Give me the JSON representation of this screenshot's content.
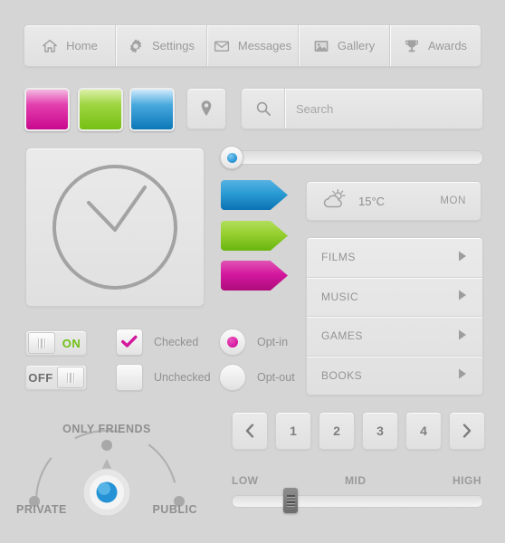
{
  "navbar": {
    "items": [
      {
        "label": "Home",
        "icon": "home-icon"
      },
      {
        "label": "Settings",
        "icon": "gear-icon"
      },
      {
        "label": "Messages",
        "icon": "envelope-icon"
      },
      {
        "label": "Gallery",
        "icon": "image-icon"
      },
      {
        "label": "Awards",
        "icon": "trophy-icon"
      }
    ]
  },
  "swatches": [
    {
      "name": "magenta",
      "color": "#c9088e"
    },
    {
      "name": "green",
      "color": "#76c013"
    },
    {
      "name": "blue",
      "color": "#0c78b8"
    }
  ],
  "pin_button": {
    "icon": "map-pin-icon"
  },
  "search": {
    "icon": "search-icon",
    "value": "",
    "placeholder": "Search"
  },
  "clock": {
    "icon": "clock-icon",
    "hour_hand": "10",
    "minute_hand": "10"
  },
  "top_slider": {
    "value": 0,
    "min": 0,
    "max": 100,
    "handle_color": "#2492d4"
  },
  "tags": [
    {
      "name": "blue",
      "color": "#0b72b3"
    },
    {
      "name": "green",
      "color": "#69b50f"
    },
    {
      "name": "magenta",
      "color": "#af0b7b"
    }
  ],
  "weather": {
    "icon": "sun-cloud-icon",
    "temperature": "15°C",
    "day": "MON"
  },
  "menu": {
    "items": [
      {
        "label": "FILMS",
        "arrow": "chevron-right-icon"
      },
      {
        "label": "MUSIC",
        "arrow": "chevron-right-icon"
      },
      {
        "label": "GAMES",
        "arrow": "chevron-right-icon"
      },
      {
        "label": "BOOKS",
        "arrow": "chevron-right-icon"
      }
    ]
  },
  "toggles": [
    {
      "name": "on",
      "label": "ON",
      "state": "on",
      "label_color": "#6fbf17"
    },
    {
      "name": "off",
      "label": "OFF",
      "state": "off",
      "label_color": "#6e6e6e"
    }
  ],
  "checkboxes": [
    {
      "label": "Checked",
      "checked": true,
      "check_color": "#d4189e"
    },
    {
      "label": "Unchecked",
      "checked": false
    }
  ],
  "radios": [
    {
      "label": "Opt-in",
      "selected": true,
      "dot_color": "#d4189e"
    },
    {
      "label": "Opt-out",
      "selected": false
    }
  ],
  "privacy_knob": {
    "top_label": "ONLY FRIENDS",
    "left_label": "PRIVATE",
    "right_label": "PUBLIC",
    "selected": "ONLY FRIENDS",
    "knob_color": "#2492d4"
  },
  "pagination": {
    "prev": "‹",
    "next": "›",
    "pages": [
      "1",
      "2",
      "3",
      "4"
    ],
    "current": "1"
  },
  "range_slider": {
    "low_label": "LOW",
    "mid_label": "MID",
    "high_label": "HIGH",
    "value": 22
  }
}
